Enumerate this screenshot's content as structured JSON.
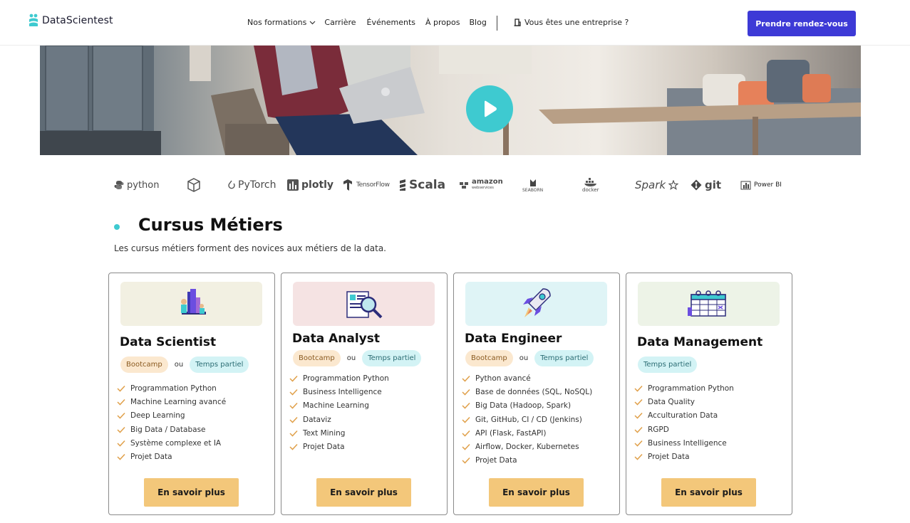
{
  "header": {
    "logo_text": "DataScientest",
    "nav": [
      {
        "label": "Nos formations",
        "has_dropdown": true
      },
      {
        "label": "Carrière"
      },
      {
        "label": "Événements"
      },
      {
        "label": "À propos"
      },
      {
        "label": "Blog"
      }
    ],
    "enterprise_label": "Vous êtes une entreprise ?",
    "cta_label": "Prendre rendez-vous"
  },
  "colors": {
    "accent": "#3ecad0",
    "cta": "#3d3ad6",
    "button": "#f3c77a"
  },
  "tech_logos": [
    "python",
    "PyTorch",
    "plotly",
    "TensorFlow",
    "Scala",
    "amazon",
    "webservices",
    "SEABORN",
    "docker",
    "Spark",
    "git",
    "Power BI"
  ],
  "section": {
    "title": "Cursus Métiers",
    "subtitle": "Les cursus métiers forment des novices aux métiers de la data."
  },
  "cards": [
    {
      "title": "Data Scientist",
      "tags": [
        "Bootcamp",
        "ou",
        "Temps partiel"
      ],
      "items": [
        "Programmation Python",
        "Machine Learning avancé",
        "Deep Learning",
        "Big Data / Database",
        "Système complexe et IA",
        "Projet Data"
      ],
      "button": "En savoir plus"
    },
    {
      "title": "Data Analyst",
      "tags": [
        "Bootcamp",
        "ou",
        "Temps partiel"
      ],
      "items": [
        "Programmation Python",
        "Business Intelligence",
        "Machine Learning",
        "Dataviz",
        "Text Mining",
        "Projet Data"
      ],
      "button": "En savoir plus"
    },
    {
      "title": "Data Engineer",
      "tags": [
        "Bootcamp",
        "ou",
        "Temps partiel"
      ],
      "items": [
        "Python avancé",
        "Base de données (SQL, NoSQL)",
        "Big Data (Hadoop, Spark)",
        "Git, GitHub, CI / CD (Jenkins)",
        "API (Flask, FastAPI)",
        "Airflow, Docker, Kubernetes",
        "Projet Data"
      ],
      "button": "En savoir plus"
    },
    {
      "title": "Data Management",
      "tags": [
        "Temps partiel"
      ],
      "items": [
        "Programmation Python",
        "Data Quality",
        "Acculturation Data",
        "RGPD",
        "Business Intelligence",
        "Projet Data"
      ],
      "button": "En savoir plus"
    }
  ]
}
